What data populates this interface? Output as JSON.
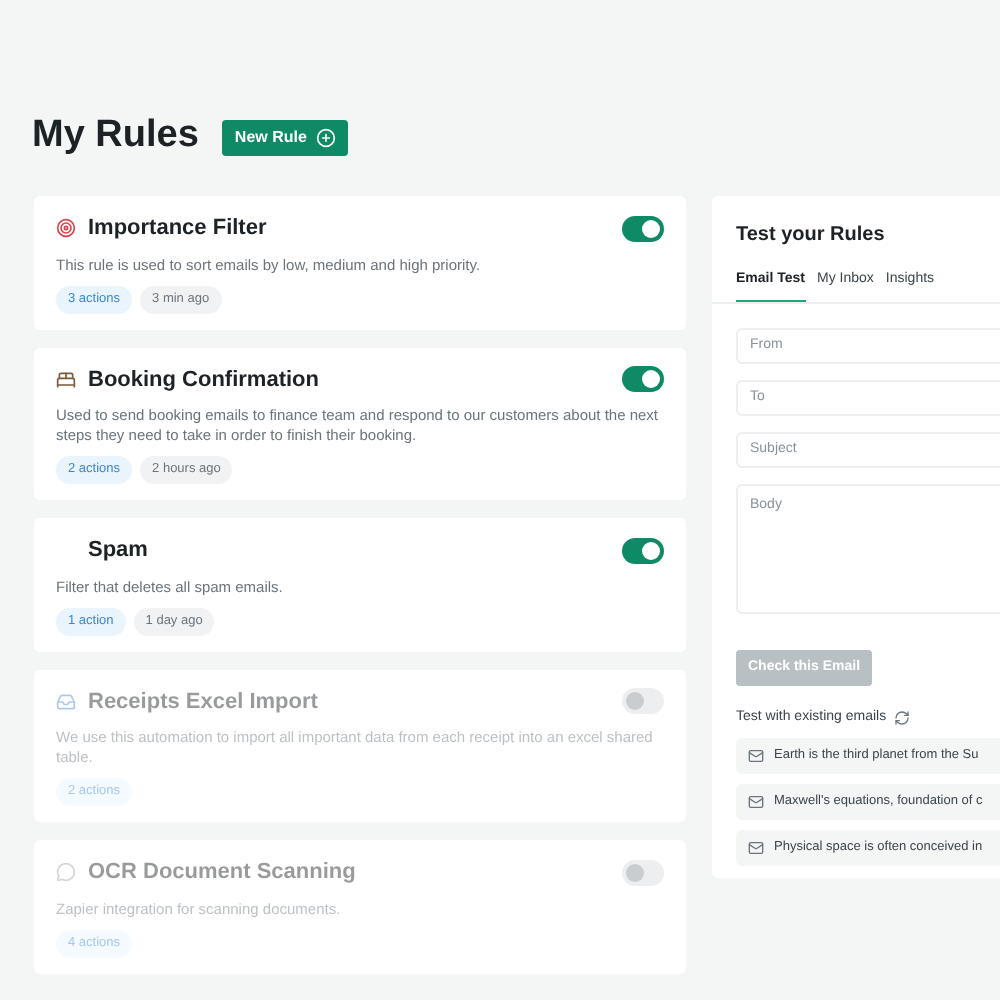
{
  "header": {
    "title": "My Rules",
    "new_button": "New Rule"
  },
  "rules": [
    {
      "name": "Importance Filter",
      "description": "This rule is used to sort emails by low, medium and high priority.",
      "actions": "3 actions",
      "time": "3 min ago",
      "on": true
    },
    {
      "name": "Booking Confirmation",
      "description": "Used to send booking emails to finance team and respond to our customers about the next steps they need to take in order to finish their booking.",
      "actions": "2 actions",
      "time": "2 hours ago",
      "on": true
    },
    {
      "name": "Spam",
      "description": "Filter that deletes all spam emails.",
      "actions": "1 action",
      "time": "1 day ago",
      "on": true
    },
    {
      "name": "Receipts Excel Import",
      "description": "We use this automation to import all important data from each receipt into an excel shared table.",
      "actions": "2 actions",
      "on": false
    },
    {
      "name": "OCR Document Scanning",
      "description": "Zapier integration for scanning documents.",
      "actions": "4 actions",
      "on": false
    }
  ],
  "test_panel": {
    "title": "Test your Rules",
    "tabs": [
      {
        "label": "Email Test",
        "selected": true
      },
      {
        "label": "My Inbox",
        "selected": false
      },
      {
        "label": "Insights",
        "selected": false
      }
    ],
    "fields": [
      {
        "placeholder": "From"
      },
      {
        "placeholder": "To"
      },
      {
        "placeholder": "Subject"
      },
      {
        "placeholder": "Body",
        "kind": "textarea"
      }
    ],
    "check_button": {
      "label": "Check this Email",
      "disabled": true
    },
    "existing_title": "Test with existing emails",
    "emails": [
      "Earth is the third planet from the Su",
      "Maxwell's equations, foundation of c",
      "Physical space is often conceived in"
    ]
  }
}
